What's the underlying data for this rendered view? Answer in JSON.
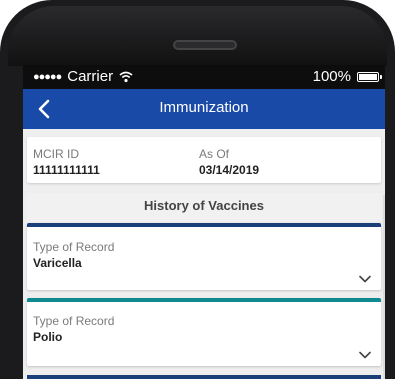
{
  "status_bar": {
    "signal": "●●●●●",
    "carrier": "Carrier",
    "battery_percent": "100%"
  },
  "nav": {
    "title": "Immunization"
  },
  "id_card": {
    "mcir_label": "MCIR ID",
    "mcir_value": "11111111111",
    "as_of_label": "As Of",
    "as_of_value": "03/14/2019"
  },
  "history": {
    "header": "History of Vaccines",
    "records": [
      {
        "label": "Type of Record",
        "value": "Varicella",
        "accent": "#1a3f7a"
      },
      {
        "label": "Type of Record",
        "value": "Polio",
        "accent": "#0f8a8f"
      }
    ]
  },
  "colors": {
    "navbar": "#1a4aa8",
    "background": "#eeeeee"
  }
}
